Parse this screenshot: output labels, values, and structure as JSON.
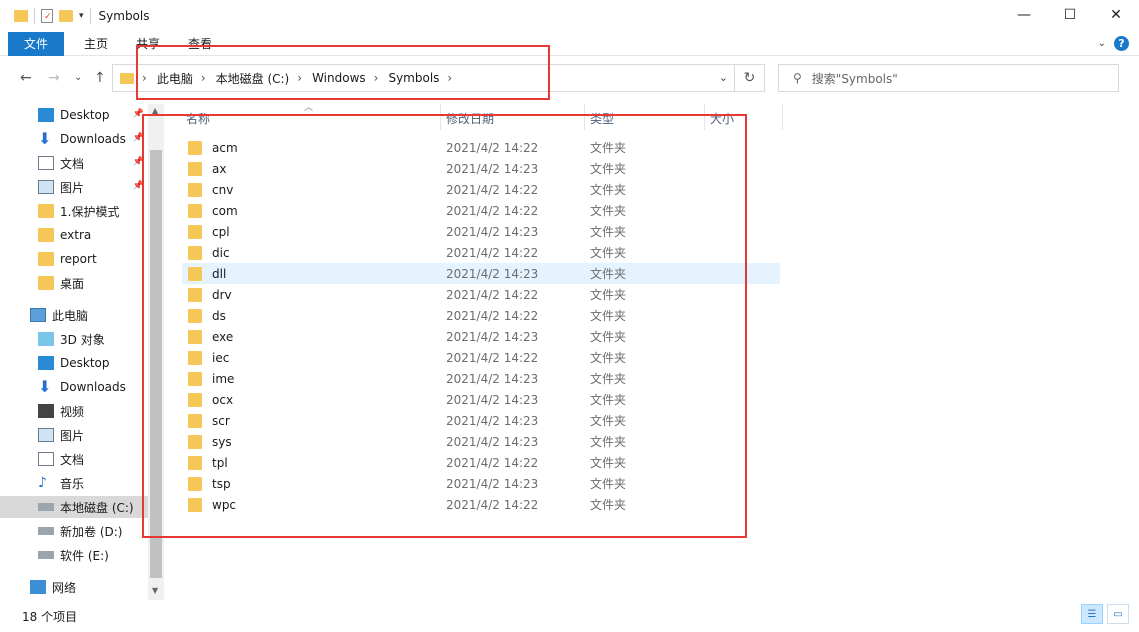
{
  "window": {
    "title": "Symbols",
    "minimize": "—",
    "maximize": "☐",
    "close": "✕"
  },
  "ribbon": {
    "file_tab": "文件",
    "tabs": [
      "主页",
      "共享",
      "查看"
    ],
    "help": "?"
  },
  "nav": {
    "back": "←",
    "forward": "→",
    "recent": "⌄",
    "up": "↑"
  },
  "address": {
    "breadcrumbs": [
      "此电脑",
      "本地磁盘 (C:)",
      "Windows",
      "Symbols"
    ],
    "dropdown": "⌄",
    "refresh": "↻"
  },
  "search": {
    "placeholder": "搜索\"Symbols\""
  },
  "sidebar": {
    "items": [
      {
        "label": "Desktop",
        "icon": "desktop-icon",
        "pinned": true
      },
      {
        "label": "Downloads",
        "icon": "download-icon",
        "pinned": true
      },
      {
        "label": "文档",
        "icon": "document-icon",
        "pinned": true
      },
      {
        "label": "图片",
        "icon": "picture-icon",
        "pinned": true
      },
      {
        "label": "1.保护模式",
        "icon": "folder-icon",
        "pinned": false
      },
      {
        "label": "extra",
        "icon": "folder-icon",
        "pinned": false
      },
      {
        "label": "report",
        "icon": "folder-icon",
        "pinned": false
      },
      {
        "label": "桌面",
        "icon": "folder-icon",
        "pinned": false
      },
      {
        "label": "此电脑",
        "icon": "computer-icon",
        "pinned": false
      },
      {
        "label": "3D 对象",
        "icon": "3d-objects-icon",
        "pinned": false
      },
      {
        "label": "Desktop",
        "icon": "desktop-icon",
        "pinned": false
      },
      {
        "label": "Downloads",
        "icon": "download-icon",
        "pinned": false
      },
      {
        "label": "视频",
        "icon": "video-icon",
        "pinned": false
      },
      {
        "label": "图片",
        "icon": "picture-icon",
        "pinned": false
      },
      {
        "label": "文档",
        "icon": "document-icon",
        "pinned": false
      },
      {
        "label": "音乐",
        "icon": "music-icon",
        "pinned": false
      },
      {
        "label": "本地磁盘 (C:)",
        "icon": "drive-icon",
        "pinned": false,
        "selected": true
      },
      {
        "label": "新加卷 (D:)",
        "icon": "drive-icon",
        "pinned": false
      },
      {
        "label": "软件 (E:)",
        "icon": "drive-icon",
        "pinned": false
      },
      {
        "label": "网络",
        "icon": "network-icon",
        "pinned": false
      }
    ]
  },
  "columns": {
    "name": "名称",
    "date": "修改日期",
    "type": "类型",
    "size": "大小"
  },
  "files": [
    {
      "name": "acm",
      "date": "2021/4/2 14:22",
      "type": "文件夹"
    },
    {
      "name": "ax",
      "date": "2021/4/2 14:23",
      "type": "文件夹"
    },
    {
      "name": "cnv",
      "date": "2021/4/2 14:22",
      "type": "文件夹"
    },
    {
      "name": "com",
      "date": "2021/4/2 14:22",
      "type": "文件夹"
    },
    {
      "name": "cpl",
      "date": "2021/4/2 14:23",
      "type": "文件夹"
    },
    {
      "name": "dic",
      "date": "2021/4/2 14:22",
      "type": "文件夹"
    },
    {
      "name": "dll",
      "date": "2021/4/2 14:23",
      "type": "文件夹",
      "hover": true
    },
    {
      "name": "drv",
      "date": "2021/4/2 14:22",
      "type": "文件夹"
    },
    {
      "name": "ds",
      "date": "2021/4/2 14:22",
      "type": "文件夹"
    },
    {
      "name": "exe",
      "date": "2021/4/2 14:23",
      "type": "文件夹"
    },
    {
      "name": "iec",
      "date": "2021/4/2 14:22",
      "type": "文件夹"
    },
    {
      "name": "ime",
      "date": "2021/4/2 14:23",
      "type": "文件夹"
    },
    {
      "name": "ocx",
      "date": "2021/4/2 14:23",
      "type": "文件夹"
    },
    {
      "name": "scr",
      "date": "2021/4/2 14:23",
      "type": "文件夹"
    },
    {
      "name": "sys",
      "date": "2021/4/2 14:23",
      "type": "文件夹"
    },
    {
      "name": "tpl",
      "date": "2021/4/2 14:22",
      "type": "文件夹"
    },
    {
      "name": "tsp",
      "date": "2021/4/2 14:23",
      "type": "文件夹"
    },
    {
      "name": "wpc",
      "date": "2021/4/2 14:22",
      "type": "文件夹"
    }
  ],
  "status": {
    "item_count": "18 个项目"
  },
  "colors": {
    "accent": "#1979ca",
    "folder": "#f4c756",
    "highlight": "#e53935",
    "hover": "#e5f3ff"
  }
}
